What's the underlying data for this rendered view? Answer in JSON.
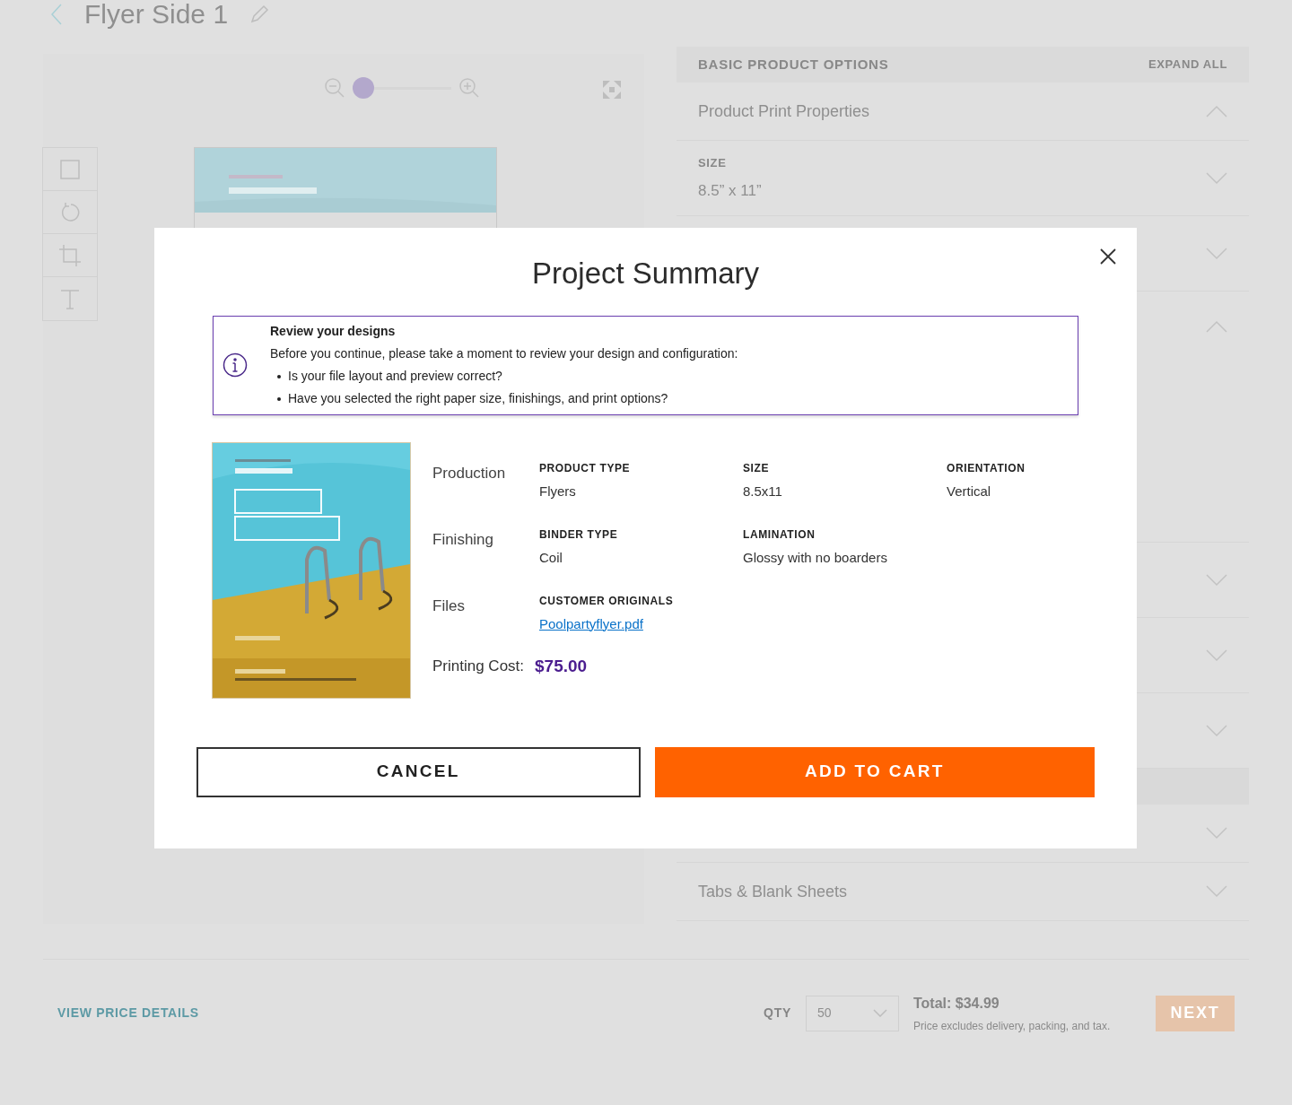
{
  "page": {
    "title": "Flyer Side 1"
  },
  "canvas": {
    "zoom": {
      "level": 0
    }
  },
  "options_panel": {
    "title": "BASIC PRODUCT OPTIONS",
    "action": "EXPAND ALL",
    "items": [
      {
        "kind": "section",
        "label": "Product Print Properties",
        "expanded": true
      },
      {
        "kind": "field",
        "label": "SIZE",
        "value": "8.5” x 11”",
        "expanded": false
      },
      {
        "kind": "field",
        "expanded": false
      },
      {
        "kind": "field",
        "expanded": true
      },
      {
        "kind": "field",
        "expanded": false
      },
      {
        "kind": "field",
        "expanded": false
      },
      {
        "kind": "field",
        "expanded": false
      },
      {
        "kind": "band"
      },
      {
        "kind": "section",
        "expanded": false
      },
      {
        "kind": "section",
        "label": "Tabs & Blank Sheets",
        "expanded": false
      }
    ]
  },
  "footer": {
    "price_link": "VIEW PRICE DETAILS",
    "qty_label": "QTY",
    "qty_value": "50",
    "total": "Total: $34.99",
    "note": "Price excludes delivery, packing, and tax.",
    "next": "NEXT"
  },
  "modal": {
    "title": "Project Summary",
    "notice": {
      "title": "Review your designs",
      "text": "Before you continue, please take a moment to review your design and configuration:",
      "bullets": [
        "Is your file layout and preview correct?",
        "Have you selected the right paper size, finishings, and print options?"
      ]
    },
    "groups": [
      {
        "label": "Production",
        "fields": [
          {
            "name": "PRODUCT TYPE",
            "value": "Flyers"
          },
          {
            "name": "SIZE",
            "value": "8.5x11"
          },
          {
            "name": "ORIENTATION",
            "value": "Vertical"
          }
        ]
      },
      {
        "label": "Finishing",
        "fields": [
          {
            "name": "BINDER TYPE",
            "value": "Coil"
          },
          {
            "name": "LAMINATION",
            "value": "Glossy with no boarders"
          }
        ]
      },
      {
        "label": "Files",
        "fields": [
          {
            "name": "CUSTOMER ORIGINALS",
            "value": "Poolpartyflyer.pdf",
            "kind": "link"
          }
        ]
      }
    ],
    "cost": {
      "label": "Printing Cost:",
      "value": "$75.00"
    },
    "buttons": [
      {
        "label": "CANCEL",
        "kind": "secondary"
      },
      {
        "label": "ADD TO CART",
        "kind": "primary"
      }
    ]
  }
}
